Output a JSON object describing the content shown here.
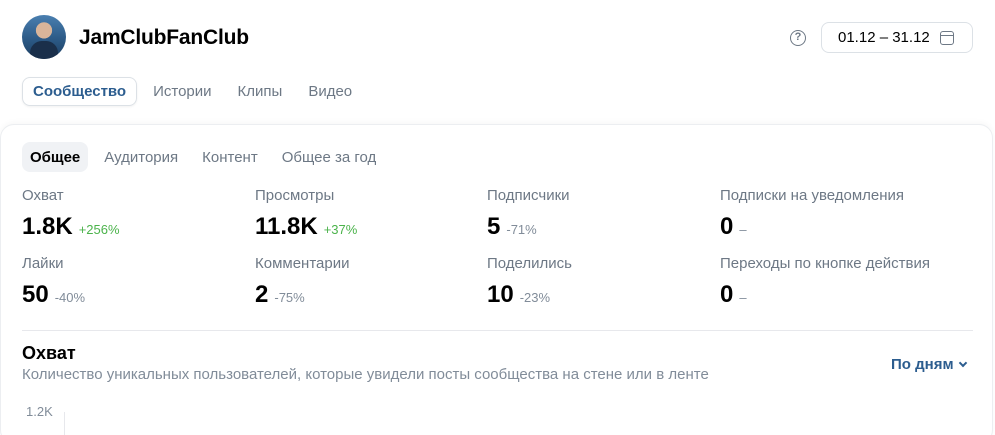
{
  "header": {
    "title": "JamClubFanClub",
    "help_icon": "question-circle-icon",
    "date_range": "01.12 – 31.12",
    "calendar_icon": "calendar-icon"
  },
  "top_tabs": [
    {
      "label": "Сообщество",
      "active": true
    },
    {
      "label": "Истории",
      "active": false
    },
    {
      "label": "Клипы",
      "active": false
    },
    {
      "label": "Видео",
      "active": false
    }
  ],
  "sub_tabs": [
    {
      "label": "Общее",
      "active": true
    },
    {
      "label": "Аудитория",
      "active": false
    },
    {
      "label": "Контент",
      "active": false
    },
    {
      "label": "Общее за год",
      "active": false
    }
  ],
  "stats": [
    {
      "label": "Охват",
      "value": "1.8K",
      "delta": "+256%",
      "trend": "up"
    },
    {
      "label": "Просмотры",
      "value": "11.8K",
      "delta": "+37%",
      "trend": "up"
    },
    {
      "label": "Подписчики",
      "value": "5",
      "delta": "-71%",
      "trend": "down"
    },
    {
      "label": "Подписки на уведомления",
      "value": "0",
      "delta": "–",
      "trend": "none"
    },
    {
      "label": "Лайки",
      "value": "50",
      "delta": "-40%",
      "trend": "down"
    },
    {
      "label": "Комментарии",
      "value": "2",
      "delta": "-75%",
      "trend": "down"
    },
    {
      "label": "Поделились",
      "value": "10",
      "delta": "-23%",
      "trend": "down"
    },
    {
      "label": "Переходы по кнопке действия",
      "value": "0",
      "delta": "–",
      "trend": "none"
    }
  ],
  "section": {
    "title": "Охват",
    "description": "Количество уникальных пользователей, которые увидели посты сообщества на стене или в ленте",
    "grouping": "По дням",
    "chevron_icon": "chevron-down-icon",
    "y_tick": "1.2K"
  },
  "colors": {
    "accent": "#2c5d8f",
    "positive": "#4bb34b",
    "muted": "#818c99"
  }
}
